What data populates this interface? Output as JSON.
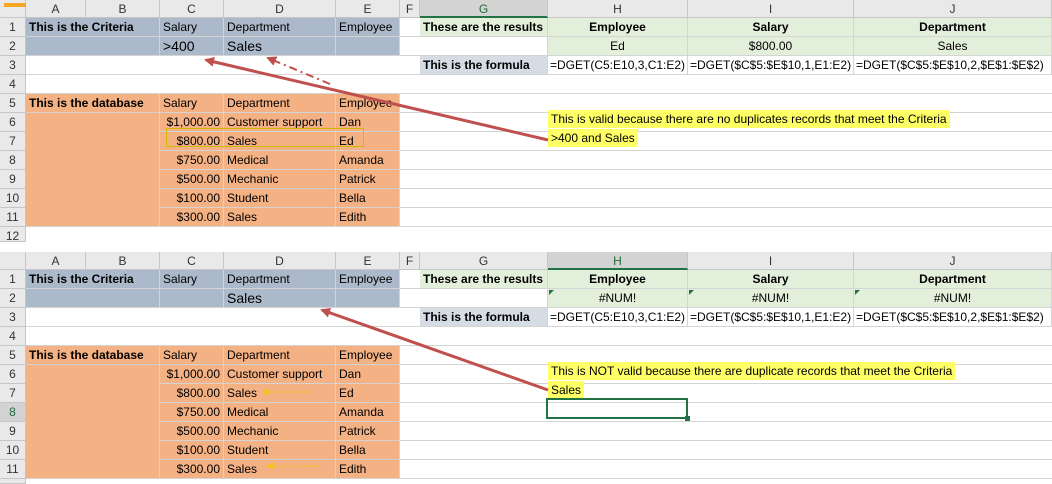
{
  "columns": [
    "A",
    "B",
    "C",
    "D",
    "E",
    "F",
    "G",
    "H",
    "I",
    "J"
  ],
  "rows": [
    "1",
    "2",
    "3",
    "4",
    "5",
    "6",
    "7",
    "8",
    "9",
    "10",
    "11",
    "12"
  ],
  "criteria": {
    "title": "This is the Criteria",
    "headers": [
      "Salary",
      "Department",
      "Employee"
    ],
    "top_values": [
      ">400",
      "Sales",
      ""
    ],
    "bottom_values": [
      "",
      "Sales",
      ""
    ]
  },
  "database": {
    "title": "This is the database",
    "headers": [
      "Salary",
      "Department",
      "Employee"
    ],
    "rows": [
      [
        "$1,000.00",
        "Customer support",
        "Dan"
      ],
      [
        "$800.00",
        "Sales",
        "Ed"
      ],
      [
        "$750.00",
        "Medical",
        "Amanda"
      ],
      [
        "$500.00",
        "Mechanic",
        "Patrick"
      ],
      [
        "$100.00",
        "Student",
        "Bella"
      ],
      [
        "$300.00",
        "Sales",
        "Edith"
      ]
    ]
  },
  "results": {
    "title": "These are the results",
    "headers": [
      "Employee",
      "Salary",
      "Department"
    ],
    "top_values": [
      "Ed",
      "$800.00",
      "Sales"
    ],
    "bottom_values": [
      "#NUM!",
      "#NUM!",
      "#NUM!"
    ]
  },
  "formula": {
    "label": "This is the formula",
    "values": [
      "=DGET(C5:E10,3,C1:E2)",
      "=DGET($C$5:$E$10,1,E1:E2)",
      "=DGET($C$5:$E$10,2,$E$1:$E$2)"
    ]
  },
  "notes": {
    "top_line1": "This is valid because there are no duplicates records that meet the Criteria",
    "top_line2": ">400 and Sales",
    "bottom_line1": "This is NOT valid because there are duplicate records that meet the Criteria",
    "bottom_line2": "Sales"
  },
  "colors": {
    "criteria_fill": "#acb9ca",
    "database_fill": "#f4b183",
    "results_fill": "#e2efda",
    "formula_fill": "#d6dce4",
    "note_fill": "#ffff66",
    "arrow": "#c0504d",
    "selection": "#217346"
  }
}
